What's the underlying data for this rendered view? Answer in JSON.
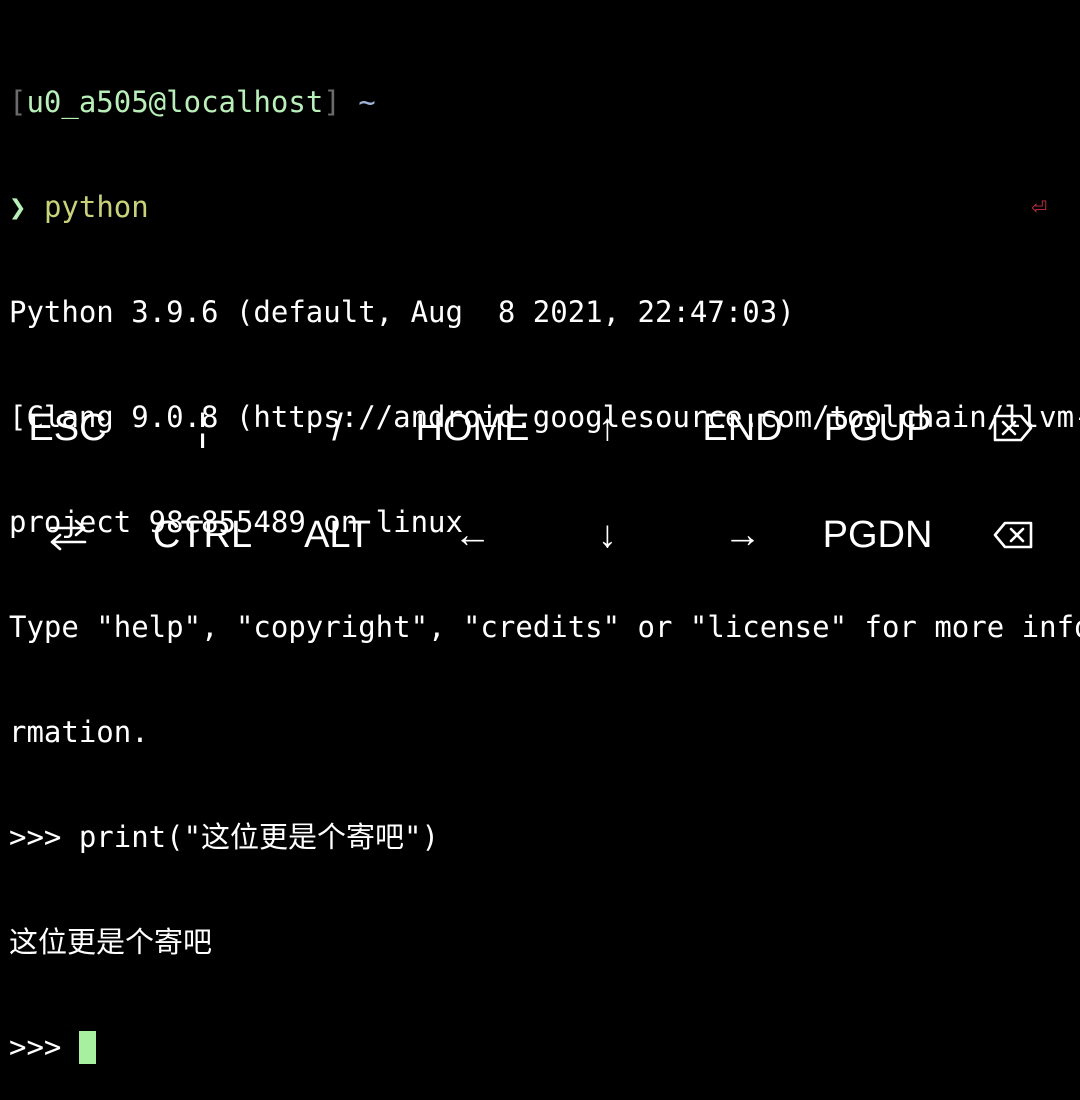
{
  "terminal": {
    "prompt": {
      "open_bracket": "[",
      "user_host": "u0_a505@localhost",
      "close_bracket": "]",
      "path": "~"
    },
    "command_line": {
      "arrow": "❯",
      "command": "python",
      "return_icon": "⏎"
    },
    "output": [
      "Python 3.9.6 (default, Aug  8 2021, 22:47:03)",
      "[Clang 9.0.8 (https://android.googlesource.com/toolchain/llvm-",
      "project 98c855489 on linux",
      "Type \"help\", \"copyright\", \"credits\" or \"license\" for more info",
      "rmation.",
      ">>> print(\"这位更是个寄吧\")",
      "这位更是个寄吧"
    ],
    "current_prompt": ">>> "
  },
  "extra_keys": {
    "row1": [
      {
        "label": "ESC",
        "icon": ""
      },
      {
        "label": "¦",
        "icon": ""
      },
      {
        "label": "/",
        "icon": ""
      },
      {
        "label": "HOME",
        "icon": ""
      },
      {
        "label": "↑",
        "icon": "arrow-up-icon"
      },
      {
        "label": "END",
        "icon": ""
      },
      {
        "label": "PGUP",
        "icon": ""
      },
      {
        "label": "",
        "icon": "delete-forward-icon"
      }
    ],
    "row2": [
      {
        "label": "",
        "icon": "tab-swap-icon"
      },
      {
        "label": "CTRL",
        "icon": ""
      },
      {
        "label": "ALT",
        "icon": ""
      },
      {
        "label": "←",
        "icon": "arrow-left-icon"
      },
      {
        "label": "↓",
        "icon": "arrow-down-icon"
      },
      {
        "label": "→",
        "icon": "arrow-right-icon"
      },
      {
        "label": "PGDN",
        "icon": ""
      },
      {
        "label": "",
        "icon": "backspace-icon"
      }
    ]
  },
  "colors": {
    "background": "#000000",
    "text": "#ffffff",
    "prompt_user": "#b9f0b9",
    "prompt_bracket": "#6b6b6b",
    "command": "#c9d27a",
    "return_icon": "#c8323c",
    "cursor": "#a6f0a0"
  }
}
